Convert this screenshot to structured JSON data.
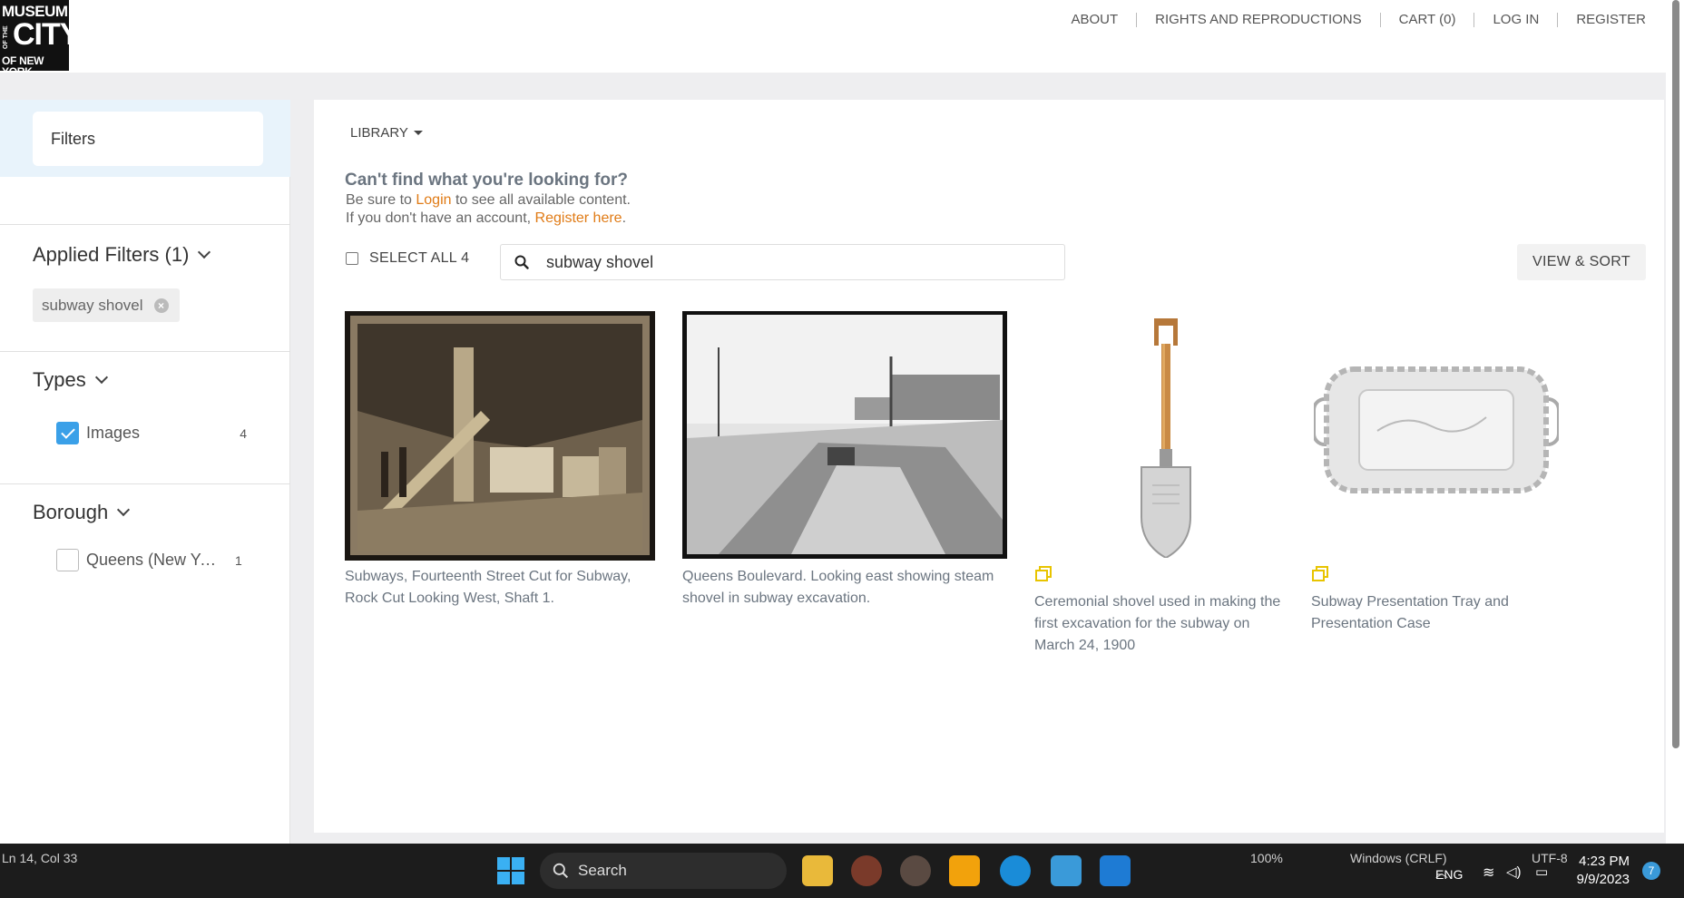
{
  "logo": {
    "line1": "MUSEUM",
    "line2": "OF THE",
    "line3": "CITY",
    "line4": "OF NEW YORK"
  },
  "topnav": [
    "ABOUT",
    "RIGHTS AND REPRODUCTIONS",
    "CART (0)",
    "LOG IN",
    "REGISTER"
  ],
  "sidebar": {
    "filters_label": "Filters",
    "applied_filters_title": "Applied Filters (1)",
    "applied_chip": "subway shovel",
    "types_title": "Types",
    "types": [
      {
        "label": "Images",
        "count": "4",
        "checked": true
      }
    ],
    "borough_title": "Borough",
    "boroughs": [
      {
        "label": "Queens (New York, N.Y.)",
        "count": "1",
        "checked": false
      }
    ]
  },
  "main": {
    "library_label": "LIBRARY",
    "cant_find": "Can't find what you're looking for?",
    "line1_pre": "Be sure to ",
    "line1_link": "Login",
    "line1_post": " to see all available content.",
    "line2_pre": "If you don't have an account, ",
    "line2_link": "Register here",
    "line2_post": ".",
    "select_all": "SELECT ALL 4",
    "search_value": "subway shovel",
    "view_sort": "VIEW & SORT",
    "results": [
      {
        "caption": "Subways, Fourteenth Street Cut for Subway, Rock Cut Looking West, Shaft 1.",
        "kind": "photo-sepia"
      },
      {
        "caption": "Queens Boulevard. Looking east showing steam shovel in subway excavation.",
        "kind": "photo-bw"
      },
      {
        "caption": "Ceremonial shovel used in making the first excavation for the subway on March 24, 1900",
        "kind": "object-shovel"
      },
      {
        "caption": "Subway Presentation Tray and Presentation Case",
        "kind": "object-tray"
      }
    ]
  },
  "statusbar": {
    "position": "Ln 14, Col 33",
    "zoom": "100%",
    "line_ending": "Windows (CRLF)",
    "encoding": "UTF-8",
    "lang": "ENG",
    "time": "4:23 PM",
    "date": "9/9/2023",
    "notifications": "7",
    "search_label": "Search"
  },
  "colors": {
    "accent_orange": "#e07b16",
    "checkbox_blue": "#3aa0e8",
    "filters_bg": "#e8f3fb"
  }
}
